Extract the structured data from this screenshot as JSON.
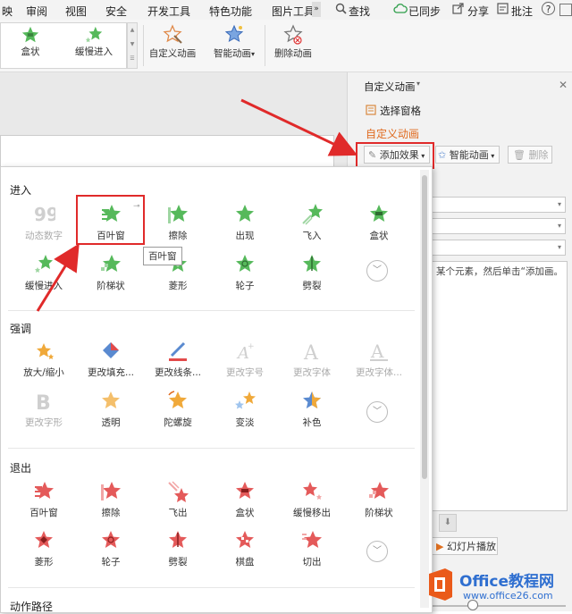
{
  "menu": {
    "items": [
      "映",
      "审阅",
      "视图",
      "安全",
      "开发工具",
      "特色功能",
      "图片工具",
      "查找",
      "已同步",
      "分享",
      "批注",
      "?"
    ],
    "more_glyph": "»"
  },
  "ribbon": {
    "gallery": [
      "盒状",
      "缓慢进入"
    ],
    "custom_animation": "自定义动画",
    "smart_animation": "智能动画",
    "delete_animation": "删除动画"
  },
  "taskpane": {
    "title": "自定义动画",
    "select_pane": "选择窗格",
    "section_title": "自定义动画",
    "add_effect": "添加效果",
    "smart_animation": "智能动画",
    "delete": "删除",
    "hint": "某个元素，然后单击“添加画。",
    "slideshow": "幻灯片播放"
  },
  "panel": {
    "sections": {
      "enter": "进入",
      "emphasis": "强调",
      "exit": "退出",
      "path": "动作路径"
    },
    "enter_items": [
      "动态数字",
      "百叶窗",
      "擦除",
      "出现",
      "飞入",
      "盒状",
      "缓慢进入",
      "阶梯状",
      "菱形",
      "轮子",
      "劈裂"
    ],
    "emphasis_items": [
      "放大/缩小",
      "更改填充...",
      "更改线条...",
      "更改字号",
      "更改字体",
      "更改字体...",
      "更改字形",
      "透明",
      "陀螺旋",
      "变淡",
      "补色"
    ],
    "exit_items": [
      "百叶窗",
      "擦除",
      "飞出",
      "盒状",
      "缓慢移出",
      "阶梯状",
      "菱形",
      "轮子",
      "劈裂",
      "棋盘",
      "切出"
    ],
    "tooltip": "百叶窗"
  },
  "watermark": {
    "brand": "Office教程网",
    "url": "www.office26.com"
  },
  "colors": {
    "enter": "#56b95b",
    "exit": "#e45a5a",
    "emph_orange": "#f0a93a",
    "accent": "#e06a1e",
    "highlight": "#e02a2a"
  }
}
